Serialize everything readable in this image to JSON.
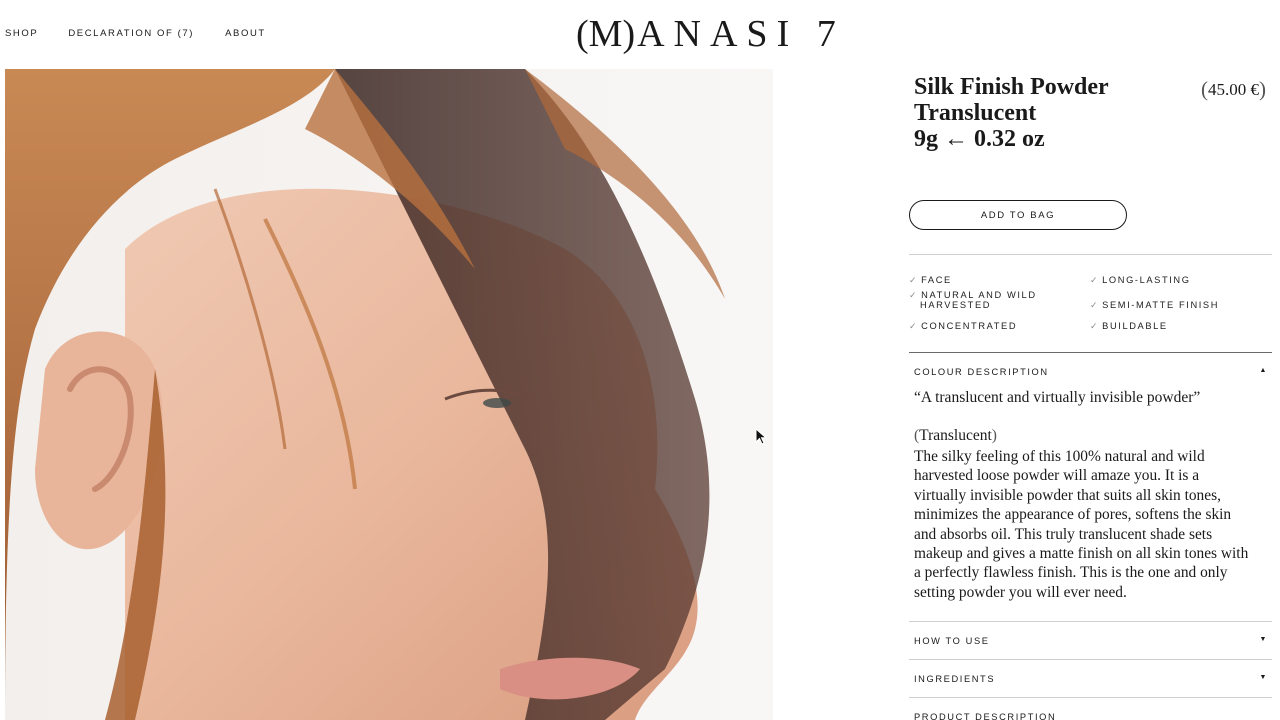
{
  "nav": {
    "items": [
      "SHOP",
      "DECLARATION OF (7)",
      "ABOUT"
    ]
  },
  "logo": {
    "mark": "(M)",
    "rest": "ANASI 7"
  },
  "product": {
    "title_lines": [
      "Silk Finish Powder",
      "Translucent",
      "9g ← 0.32 oz"
    ],
    "price_open": "(",
    "price": "45.00 €",
    "price_close": ")",
    "add_to_bag": "ADD TO BAG"
  },
  "features": {
    "left": [
      {
        "check": "✓",
        "lines": [
          "FACE"
        ]
      },
      {
        "check": "✓",
        "lines": [
          "NATURAL AND WILD",
          "HARVESTED"
        ]
      },
      {
        "check": "✓",
        "lines": [
          "CONCENTRATED"
        ]
      }
    ],
    "right": [
      {
        "check": "✓",
        "lines": [
          "LONG-LASTING"
        ]
      },
      {
        "check": "✓",
        "lines": [
          "SEMI-MATTE FINISH"
        ]
      },
      {
        "check": "✓",
        "lines": [
          "BUILDABLE"
        ]
      }
    ]
  },
  "accordion": {
    "colour_description": {
      "label": "COLOUR DESCRIPTION",
      "arrow": "▲",
      "quote": "“A translucent and virtually invisible powder”",
      "shade_open": "(",
      "shade": "Translucent",
      "shade_close": ")",
      "description_lines": [
        "The silky feeling of this 100% natural and wild",
        "harvested loose powder will amaze you. It is a",
        "virtually invisible powder that suits all skin tones,",
        "minimizes the appearance of pores, softens the skin",
        "and absorbs oil. This truly translucent shade sets",
        "makeup and gives a matte finish on all skin tones with",
        "a perfectly flawless finish. This is the one and only",
        "setting powder you will ever need."
      ]
    },
    "how_to_use": {
      "label": "HOW TO USE",
      "arrow": "▼"
    },
    "ingredients": {
      "label": "INGREDIENTS",
      "arrow": "▼"
    },
    "product_description": {
      "label": "PRODUCT DESCRIPTION"
    }
  },
  "colors": {
    "text": "#1a1a1a",
    "rule": "#cfcfcf",
    "background": "#ffffff"
  }
}
